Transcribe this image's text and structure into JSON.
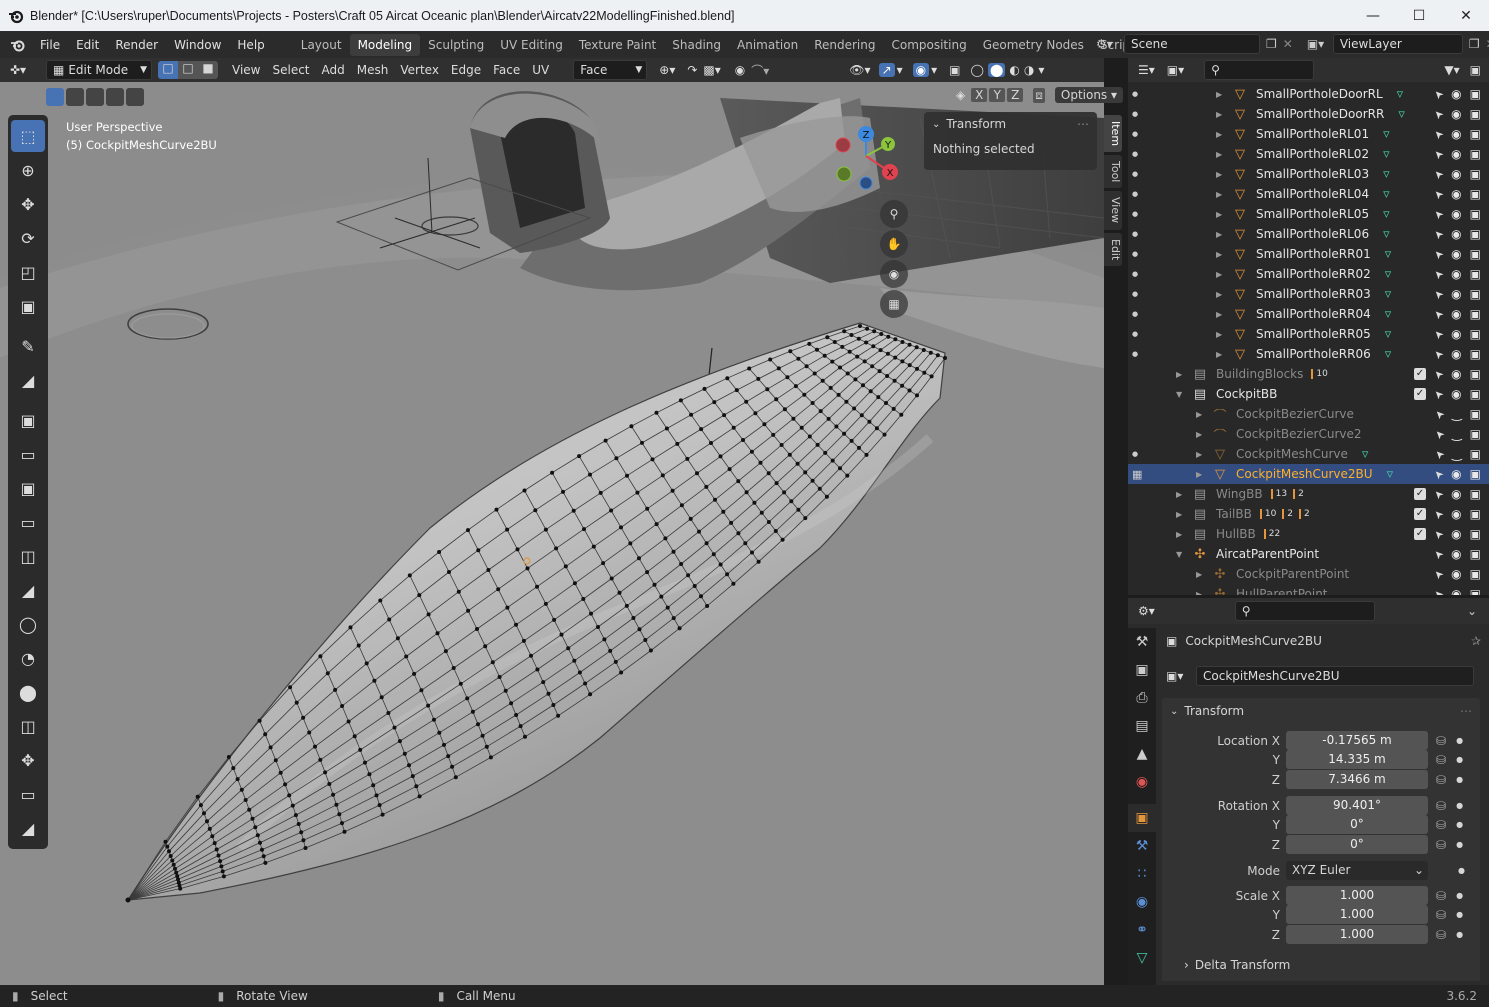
{
  "window": {
    "title": "Blender* [C:\\Users\\ruper\\Documents\\Projects - Posters\\Craft 05 Aircat Oceanic plan\\Blender\\Aircatv22ModellingFinished.blend]"
  },
  "menu": [
    "File",
    "Edit",
    "Render",
    "Window",
    "Help"
  ],
  "workspaces": [
    "Layout",
    "Modeling",
    "Sculpting",
    "UV Editing",
    "Texture Paint",
    "Shading",
    "Animation",
    "Rendering",
    "Compositing",
    "Geometry Nodes",
    "Scripting"
  ],
  "active_workspace": "Modeling",
  "scene": {
    "label": "Scene",
    "view_layer": "ViewLayer"
  },
  "viewport_header": {
    "mode": "Edit Mode",
    "menus": [
      "View",
      "Select",
      "Add",
      "Mesh",
      "Vertex",
      "Edge",
      "Face",
      "UV"
    ],
    "transform_orientation": "Face",
    "axes": [
      "X",
      "Y",
      "Z"
    ],
    "options": "Options"
  },
  "viewport": {
    "perspective": "User Perspective",
    "object": "(5) CockpitMeshCurve2BU"
  },
  "n_panel": {
    "tabs": [
      "Item",
      "Tool",
      "View",
      "Edit"
    ],
    "section": "Transform",
    "message": "Nothing selected"
  },
  "gizmo": {
    "x": "X",
    "y": "Y",
    "z": "Z"
  },
  "outliner": {
    "rows": [
      {
        "name": "SmallPortholeDoorRL",
        "indent": 3,
        "kind": "mesh",
        "muted": false
      },
      {
        "name": "SmallPortholeDoorRR",
        "indent": 3,
        "kind": "mesh",
        "muted": false
      },
      {
        "name": "SmallPortholeRL01",
        "indent": 3,
        "kind": "mesh",
        "muted": false
      },
      {
        "name": "SmallPortholeRL02",
        "indent": 3,
        "kind": "mesh",
        "muted": false
      },
      {
        "name": "SmallPortholeRL03",
        "indent": 3,
        "kind": "mesh",
        "muted": false
      },
      {
        "name": "SmallPortholeRL04",
        "indent": 3,
        "kind": "mesh",
        "muted": false
      },
      {
        "name": "SmallPortholeRL05",
        "indent": 3,
        "kind": "mesh",
        "muted": false
      },
      {
        "name": "SmallPortholeRL06",
        "indent": 3,
        "kind": "mesh",
        "muted": false
      },
      {
        "name": "SmallPortholeRR01",
        "indent": 3,
        "kind": "mesh",
        "muted": false
      },
      {
        "name": "SmallPortholeRR02",
        "indent": 3,
        "kind": "mesh",
        "muted": false
      },
      {
        "name": "SmallPortholeRR03",
        "indent": 3,
        "kind": "mesh",
        "muted": false
      },
      {
        "name": "SmallPortholeRR04",
        "indent": 3,
        "kind": "mesh",
        "muted": false
      },
      {
        "name": "SmallPortholeRR05",
        "indent": 3,
        "kind": "mesh",
        "muted": false
      },
      {
        "name": "SmallPortholeRR06",
        "indent": 3,
        "kind": "mesh",
        "muted": false
      },
      {
        "name": "BuildingBlocks",
        "indent": 1,
        "kind": "collection",
        "muted": true,
        "badge": "10"
      },
      {
        "name": "CockpitBB",
        "indent": 1,
        "kind": "collection",
        "muted": false
      },
      {
        "name": "CockpitBezierCurve",
        "indent": 2,
        "kind": "curve",
        "muted": true
      },
      {
        "name": "CockpitBezierCurve2",
        "indent": 2,
        "kind": "curve",
        "muted": true
      },
      {
        "name": "CockpitMeshCurve",
        "indent": 2,
        "kind": "mesh",
        "muted": true
      },
      {
        "name": "CockpitMeshCurve2BU",
        "indent": 2,
        "kind": "mesh",
        "muted": false,
        "selected": true
      },
      {
        "name": "WingBB",
        "indent": 1,
        "kind": "collection",
        "muted": true,
        "badge": "13",
        "badge2": "2"
      },
      {
        "name": "TailBB",
        "indent": 1,
        "kind": "collection",
        "muted": true,
        "badge": "10",
        "badge2": "2",
        "badge3": "2"
      },
      {
        "name": "HullBB",
        "indent": 1,
        "kind": "collection",
        "muted": true,
        "badge": "22"
      },
      {
        "name": "AircatParentPoint",
        "indent": 1,
        "kind": "empty",
        "muted": false
      },
      {
        "name": "CockpitParentPoint",
        "indent": 2,
        "kind": "empty",
        "muted": true
      },
      {
        "name": "HullParentPoint",
        "indent": 2,
        "kind": "empty",
        "muted": true
      }
    ]
  },
  "properties": {
    "object_name": "CockpitMeshCurve2BU",
    "object_field": "CockpitMeshCurve2BU",
    "section": "Transform",
    "location": {
      "label": "Location X",
      "x": "-0.17565 m",
      "y": "14.335 m",
      "z": "7.3466 m"
    },
    "rotation": {
      "label": "Rotation X",
      "x": "90.401°",
      "y": "0°",
      "z": "0°"
    },
    "mode_label": "Mode",
    "mode": "XYZ Euler",
    "scale": {
      "label": "Scale X",
      "x": "1.000",
      "y": "1.000",
      "z": "1.000"
    },
    "y_label": "Y",
    "z_label": "Z",
    "delta": "Delta Transform"
  },
  "status": {
    "select": "Select",
    "rotate": "Rotate View",
    "call_menu": "Call Menu",
    "version": "3.6.2"
  },
  "colors": {
    "accent": "#4772b3",
    "selected_row": "#334d80",
    "mesh_icon": "#e2953a",
    "data_icon": "#45c8a4"
  }
}
